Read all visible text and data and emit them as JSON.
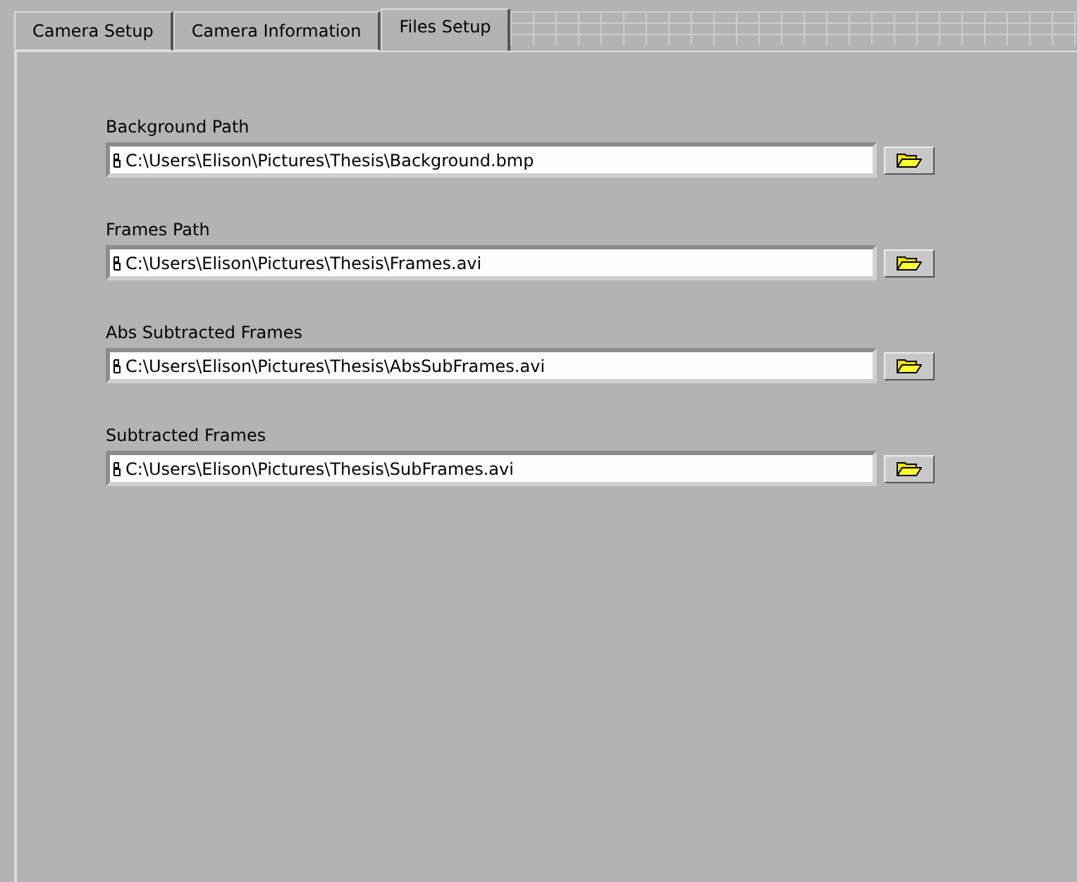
{
  "tabs": [
    {
      "label": "Camera Setup",
      "selected": false
    },
    {
      "label": "Camera Information",
      "selected": false
    },
    {
      "label": "Files Setup",
      "selected": true
    }
  ],
  "paths": [
    {
      "label": "Background Path",
      "value": "C:\\Users\\Elison\\Pictures\\Thesis\\Background.bmp"
    },
    {
      "label": "Frames Path",
      "value": "C:\\Users\\Elison\\Pictures\\Thesis\\Frames.avi"
    },
    {
      "label": "Abs Subtracted Frames",
      "value": "C:\\Users\\Elison\\Pictures\\Thesis\\AbsSubFrames.avi"
    },
    {
      "label": "Subtracted Frames",
      "value": "C:\\Users\\Elison\\Pictures\\Thesis\\SubFrames.avi"
    }
  ]
}
